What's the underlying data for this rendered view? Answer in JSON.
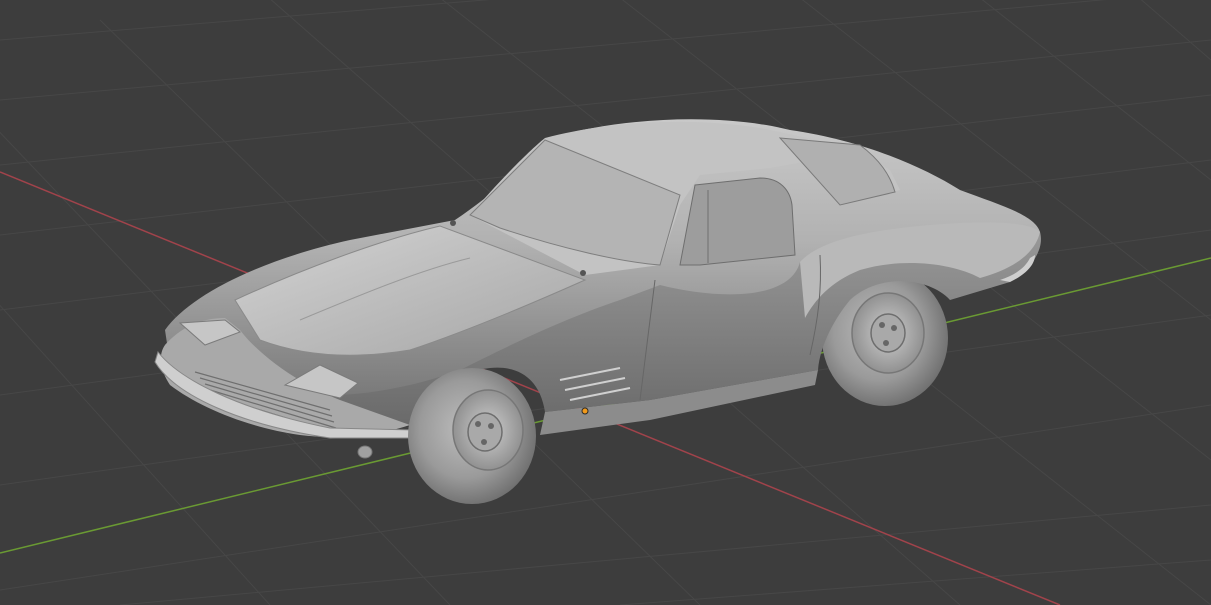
{
  "viewport": {
    "background": "#3d3d3d",
    "grid_color": "#474747",
    "x_axis_color": "#a1434b",
    "y_axis_color": "#6a9a33",
    "origin_color": "#f29a1a"
  },
  "scene": {
    "object_type": "car",
    "body_color": "#a7a7a7",
    "highlight_color": "#c7c7c7",
    "shadow_color": "#6c6c6c"
  }
}
